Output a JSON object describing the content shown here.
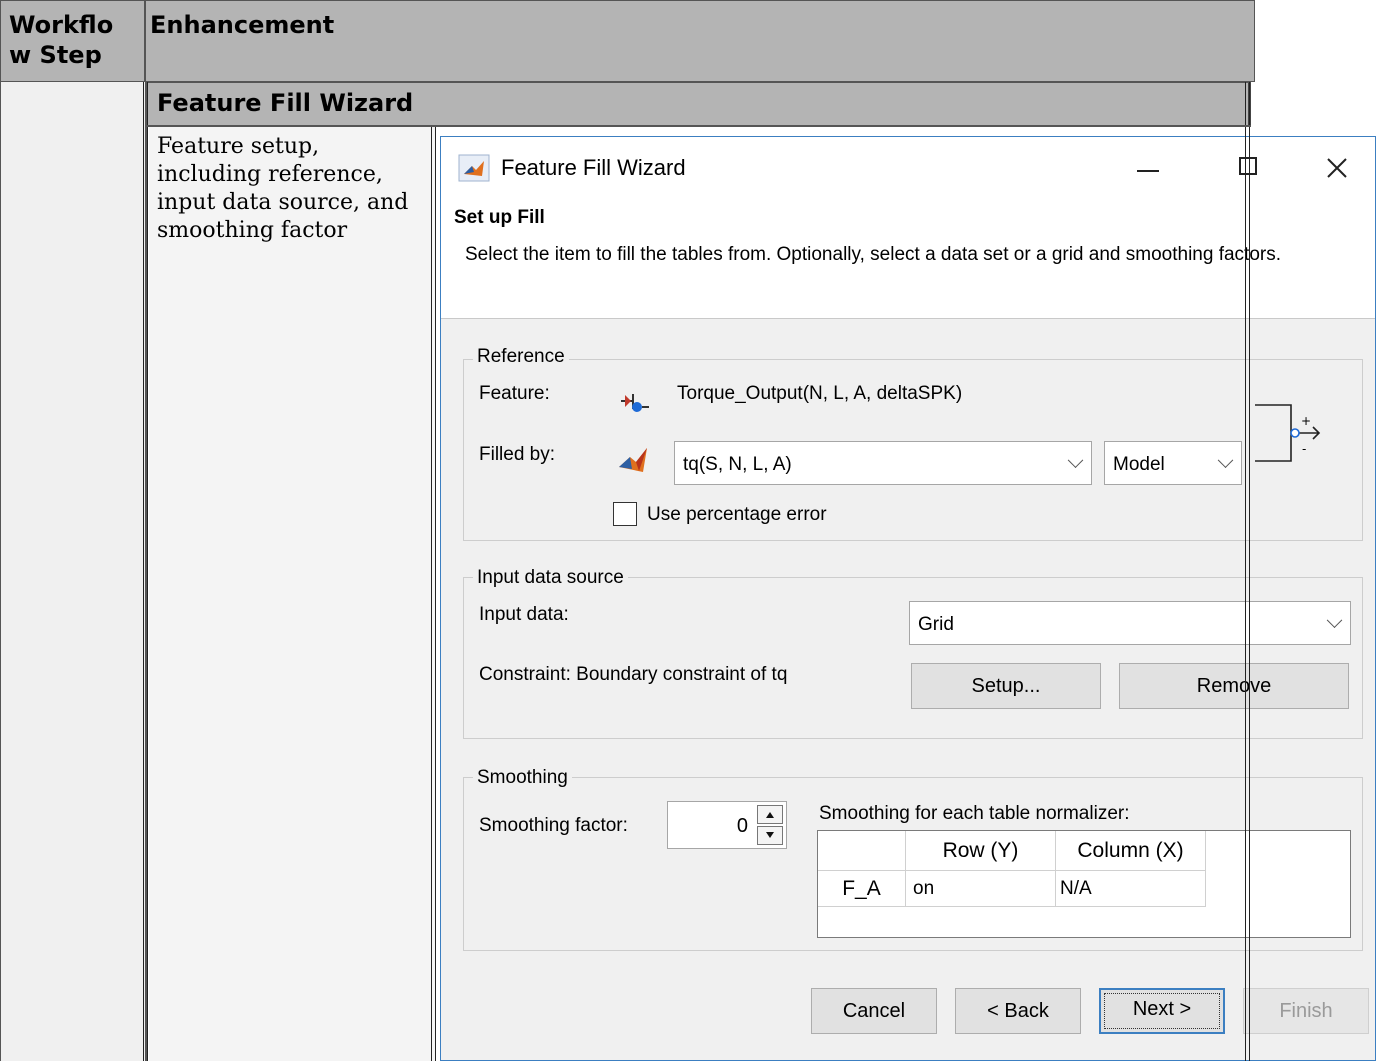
{
  "doc_table": {
    "header_col1": "Workflo\nw Step",
    "header_col2": "Enhancement",
    "section_title": "Feature Fill Wizard",
    "description": "Feature setup, including reference, input data source, and smoothing factor"
  },
  "window": {
    "title": "Feature Fill Wizard",
    "minimize_glyph": "—",
    "maximize_glyph": "☐",
    "close_glyph": "✕"
  },
  "step": {
    "title": "Set up Fill",
    "instruction": "Select the item to fill the tables from. Optionally, select a data set or a grid and smoothing factors."
  },
  "reference": {
    "legend": "Reference",
    "feature_label": "Feature:",
    "feature_value": "Torque_Output(N, L, A, deltaSPK)",
    "filled_by_label": "Filled by:",
    "filled_by_value": "tq(S, N, L, A)",
    "type_value": "Model",
    "use_percentage_label": "Use percentage error",
    "use_percentage_checked": false
  },
  "input_source": {
    "legend": "Input data source",
    "input_label": "Input data:",
    "input_value": "Grid",
    "constraint_text": "Constraint: Boundary constraint of tq",
    "setup_button": "Setup...",
    "remove_button": "Remove"
  },
  "smoothing": {
    "legend": "Smoothing",
    "factor_label": "Smoothing factor:",
    "factor_value": "0",
    "normalizer_label": "Smoothing for each table normalizer:",
    "table": {
      "columns": [
        "Row (Y)",
        "Column (X)"
      ],
      "rows": [
        {
          "name": "F_A",
          "row": "on",
          "col": "N/A"
        }
      ]
    }
  },
  "buttons": {
    "cancel": "Cancel",
    "back": "< Back",
    "next": "Next >",
    "finish": "Finish"
  },
  "colors": {
    "header_gray": "#b4b4b4",
    "window_border": "#3c7fc1",
    "dialog_bg": "#f0f0f0"
  }
}
